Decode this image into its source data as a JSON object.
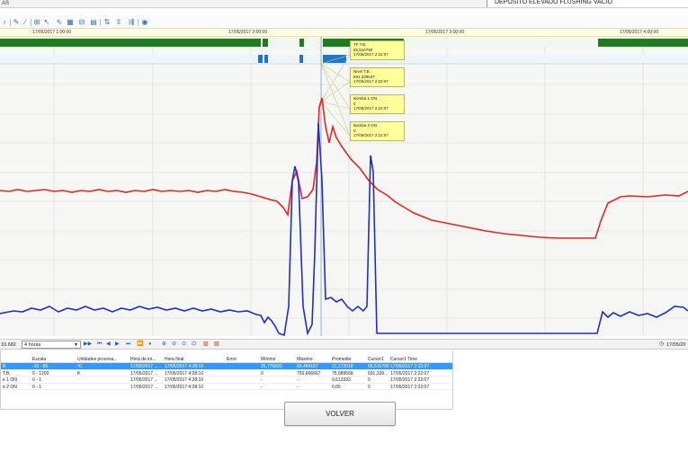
{
  "window": {
    "title": "AS",
    "right_title": "DEPOSITO ELEVADO FLUSHING VACIO"
  },
  "time_axis": {
    "labels": [
      "17/05/2017 1:00:00",
      "17/05/2017 2:00:00",
      "17/05/2017 3:00:00",
      "17/05/2017 4:00:00"
    ]
  },
  "tooltips": [
    {
      "line1": "TF T.B.",
      "line2": "65,516780",
      "line3": "17/05/2017 2:22:07"
    },
    {
      "line1": "Nivel T.B.",
      "line2": "691,339537",
      "line3": "17/05/2017 2:22:07"
    },
    {
      "line1": "Bomba 1 ON",
      "line2": "0",
      "line3": "17/05/2017 2:22:07"
    },
    {
      "line1": "Bomba 2 ON",
      "line2": "0",
      "line3": "17/05/2017 2:22:07"
    }
  ],
  "navbar": {
    "left_value": "10.682",
    "period": "4 horas",
    "right_date": "17/05/20"
  },
  "table": {
    "headers": [
      "",
      "Escala",
      "Unidades procesa...",
      "Hora de ini...",
      "Hora final",
      "Error",
      "Mínimo",
      "Máximo",
      "Promedio",
      "Cursor1",
      "Cursor1 Time"
    ],
    "rows": [
      [
        "B",
        "-10 - 85",
        "ºC",
        "17/05/2017 ...",
        "17/05/2017 4:28:10",
        "",
        "25,776833",
        "65,484167",
        "31,172018",
        "65,516780",
        "17/05/2017 2:22:07"
      ],
      [
        "T.B.",
        "0 - 1200",
        "ft",
        "17/05/2017 ...",
        "17/05/2017 4:28:10",
        "",
        "0",
        "755,666667",
        "75,689568",
        "691,339...",
        "17/05/2017 2:22:07"
      ],
      [
        "e 1 ON",
        "0 - 1",
        "",
        "17/05/2017 ...",
        "17/05/2017 4:28:10",
        "",
        "-",
        "-",
        "0,613333",
        "0",
        "17/05/2017 2:22:07"
      ],
      [
        "e 2 ON",
        "0 - 1",
        "",
        "17/05/2017 ...",
        "17/05/2017 4:28:10",
        "",
        "-",
        "-",
        "0,05",
        "0",
        "17/05/2017 2:22:07"
      ]
    ]
  },
  "buttons": {
    "volver": "VOLVER"
  },
  "colors": {
    "red_series": "#e0261f",
    "blue_series": "#1f2fc0",
    "status_bar_green": "#1e7d1e",
    "status_bar_blue": "#1a76d2",
    "tooltip_bg": "#ffff99",
    "selected_row": "#3399ff"
  }
}
